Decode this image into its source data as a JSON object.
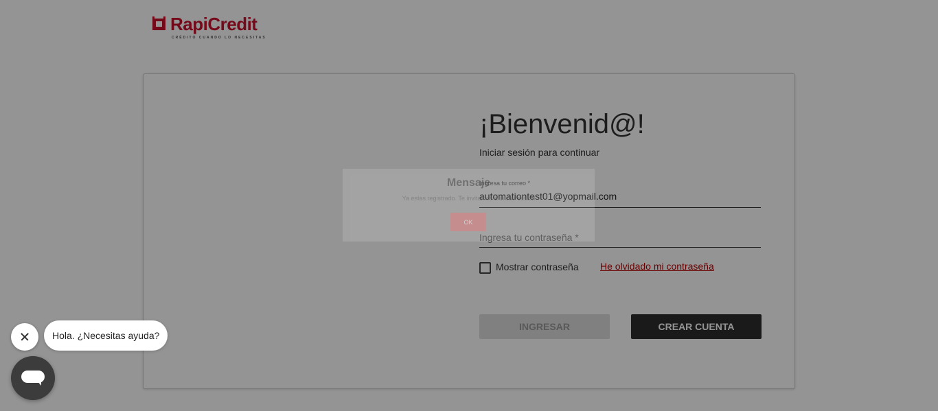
{
  "brand": {
    "name": "RapiCredit",
    "tagline": "CRÉDITO CUANDO LO NECESITAS",
    "color": "#c8102e"
  },
  "login": {
    "title": "¡Bienvenid@!",
    "subtitle": "Iniciar sesión para continuar",
    "email_label": "Ingresa tu correo *",
    "email_value": "automationtest01@yopmail.com",
    "password_placeholder": "Ingresa tu contraseña *",
    "show_password_label": "Mostrar contraseña",
    "forgot_link": "He olvidado mi contraseña",
    "login_button": "INGRESAR",
    "create_button": "CREAR CUENTA"
  },
  "modal": {
    "title": "Mensaje",
    "text": "Ya estas registrado. Te invitamos a iniciar sesión",
    "ok_button": "OK"
  },
  "chat": {
    "greeting": "Hola. ¿Necesitas ayuda?",
    "close_icon": "close-icon",
    "launcher_icon": "chat-icon"
  }
}
